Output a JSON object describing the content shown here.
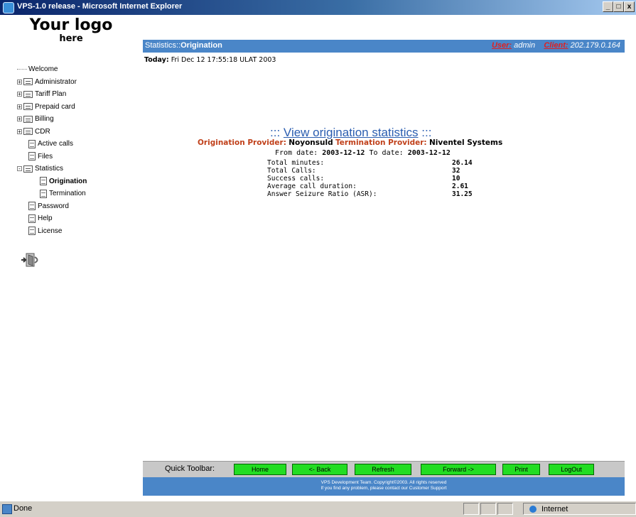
{
  "window": {
    "title": "VPS-1.0 release - Microsoft Internet Explorer",
    "minimize": "_",
    "maximize": "□",
    "close": "x"
  },
  "logo": {
    "line1": "Your logo",
    "line2": "here"
  },
  "nav": {
    "welcome": "Welcome",
    "administrator": "Administrator",
    "tariff_plan": "Tariff Plan",
    "prepaid_card": "Prepaid card",
    "billing": "Billing",
    "cdr": "CDR",
    "active_calls": "Active calls",
    "files": "Files",
    "statistics": "Statistics",
    "origination": "Origination",
    "termination": "Termination",
    "password": "Password",
    "help": "Help",
    "license": "License",
    "expand_symbol": "+",
    "collapse_symbol": "-"
  },
  "header": {
    "breadcrumb_prefix": "Statistics::",
    "breadcrumb_current": "Origination",
    "user_label": "User:",
    "user_value": "admin",
    "client_label": "Client:",
    "client_value": "202.179.0.164"
  },
  "today": {
    "label": "Today:",
    "value": "Fri Dec 12 17:55:18 ULAT 2003"
  },
  "main": {
    "link_prefix": ":::",
    "link_text": "View origination statistics",
    "link_suffix": ":::",
    "orig_provider_label": "Origination Provider:",
    "orig_provider_value": "Noyonsuld",
    "term_provider_label": "Termination Provider:",
    "term_provider_value": "Niventel Systems",
    "from_label": "From date:",
    "from_value": "2003-12-12",
    "to_label": "To date:",
    "to_value": "2003-12-12"
  },
  "stats": [
    {
      "label": "Total minutes:",
      "value": "26.14"
    },
    {
      "label": "Total Calls:",
      "value": "32"
    },
    {
      "label": "Success calls:",
      "value": "10"
    },
    {
      "label": "Average call duration:",
      "value": "2.61"
    },
    {
      "label": "Answer Seizure Ratio (ASR):",
      "value": "31.25"
    }
  ],
  "toolbar": {
    "label": "Quick Toolbar:",
    "home": "Home",
    "back": "<- Back",
    "refresh": "Refresh",
    "forward": "Forward ->",
    "print": "Print",
    "logout": "LogOut"
  },
  "footer": {
    "line1": "VPS Development Team. Copyright©2003. All rights reserved",
    "line2": "If you find any problem, please contact our Customer Support"
  },
  "status": {
    "text": "Done",
    "zone": "Internet"
  },
  "colors": {
    "header_blue": "#4a86c8",
    "accent_red": "#c0401a",
    "link_blue": "#2a5db0",
    "toolbar_green": "#22dd22"
  },
  "icons": [
    "ie-icon",
    "folder-icon",
    "document-icon",
    "exit-icon",
    "globe-icon"
  ]
}
